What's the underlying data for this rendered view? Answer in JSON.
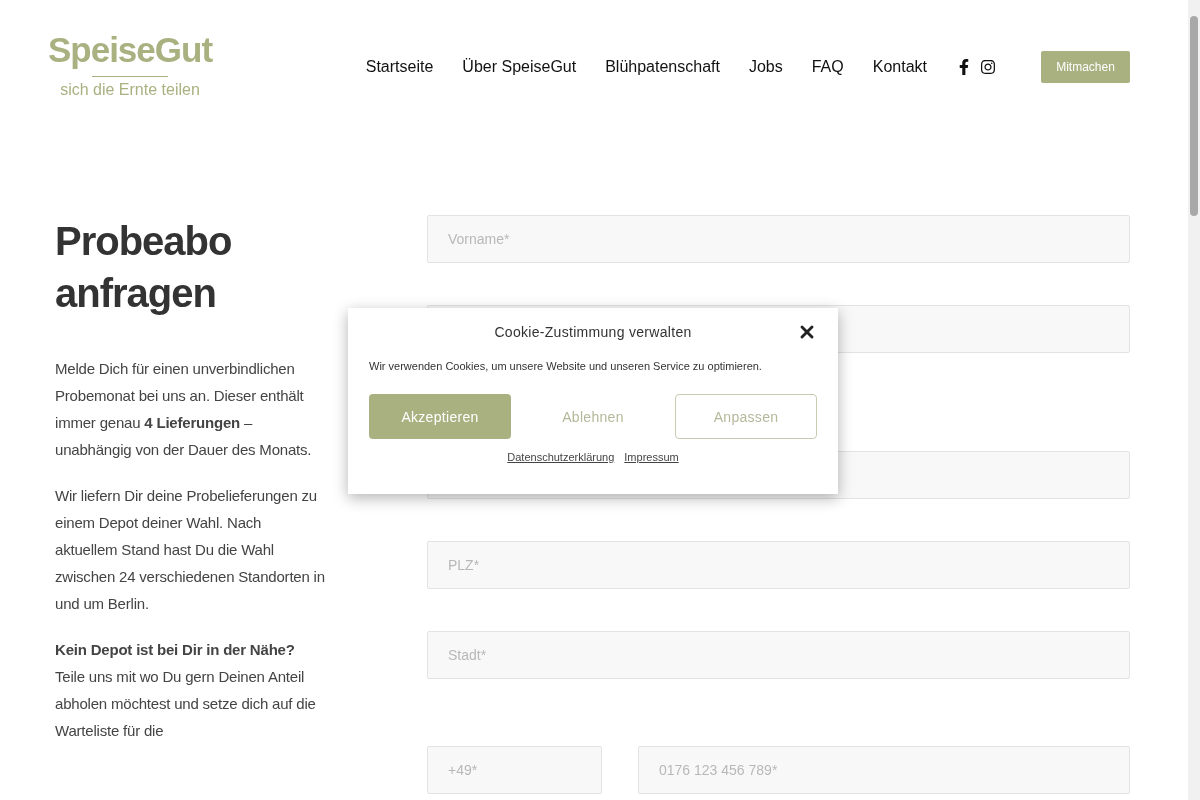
{
  "logo": {
    "name": "SpeiseGut",
    "tagline": "sich die Ernte teilen"
  },
  "nav": {
    "links": [
      "Startseite",
      "Über SpeiseGut",
      "Blühpatenschaft",
      "Jobs",
      "FAQ",
      "Kontakt"
    ],
    "social": [
      {
        "kind": "facebook"
      },
      {
        "kind": "instagram"
      }
    ],
    "cta": "Mitmachen"
  },
  "intro": {
    "title": "Probeabo anfragen",
    "paragraphs": [
      "Melde Dich für einen unverbindlichen Probemonat bei uns an. Dieser enthält immer genau **4 Lieferungen** – unabhängig von der Dauer des Monats.",
      "Wir liefern Dir deine Probelieferungen zu einem Depot deiner Wahl. Nach aktuellem Stand hast Du die Wahl zwischen 24 verschiedenen Standorten in und um Berlin.",
      "**Kein Depot ist bei Dir in der Nähe?** Teile uns mit wo Du gern Deinen Anteil abholen möchtest und setze dich auf die Warteliste für die"
    ]
  },
  "form": {
    "name_fields": [
      {
        "kind": "text",
        "placeholder": "Vorname*"
      },
      {
        "kind": "text"
      }
    ],
    "address_fields": [
      {
        "kind": "text"
      },
      {
        "kind": "text",
        "placeholder": "PLZ*"
      },
      {
        "kind": "text",
        "placeholder": "Stadt*"
      }
    ],
    "phone": {
      "prefix": {
        "placeholder": "+49*"
      },
      "number": {
        "placeholder": "0176 123 456 789*"
      }
    }
  },
  "cookie_dialog": {
    "title": "Cookie-Zustimmung verwalten",
    "text": "Wir verwenden Cookies, um unsere Website und unseren Service zu optimieren.",
    "buttons": [
      {
        "label": "Akzeptieren",
        "kind": "primary"
      },
      {
        "label": "Ablehnen",
        "kind": "plain"
      },
      {
        "label": "Anpassen",
        "kind": "outline"
      }
    ],
    "links": [
      "Datenschutzerklärung",
      "Impressum"
    ]
  }
}
